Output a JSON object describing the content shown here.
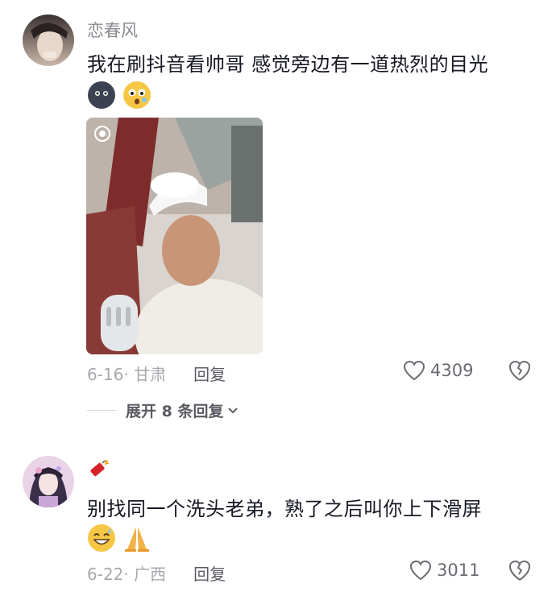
{
  "comments": [
    {
      "username": "恋春风",
      "text": "我在刷抖音看帅哥 感觉旁边有一道热烈的目光",
      "emojis": [
        "dark-face-emoji",
        "surprised-emoji"
      ],
      "date": "6-16· 甘肃",
      "reply_label": "回复",
      "likes": "4309"
    },
    {
      "username": "",
      "badge": "firecracker-icon",
      "text": "别找同一个洗头老弟，熟了之后叫你上下滑屏",
      "emojis": [
        "grin-emoji",
        "pray-emoji"
      ],
      "date": "6-22· 广西",
      "reply_label": "回复",
      "likes": "3011"
    }
  ],
  "expand_label": "展开 8 条回复",
  "colors": {
    "text": "#161823",
    "muted": "#a8a9ad",
    "meta": "#5a5b62"
  }
}
